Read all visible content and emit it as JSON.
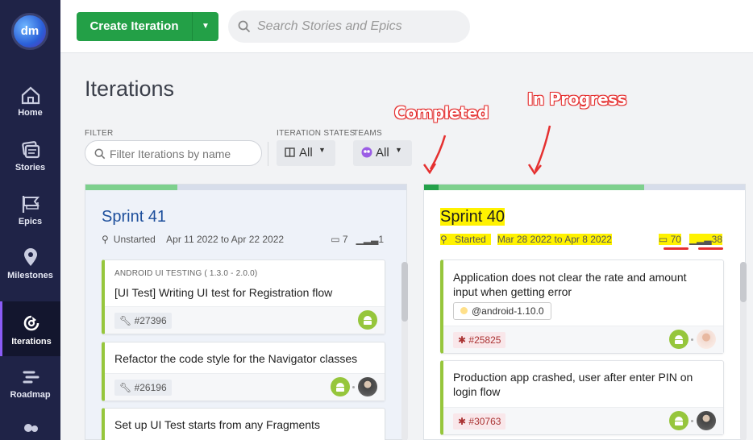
{
  "app": {
    "logo_text": "dm"
  },
  "sidebar": {
    "items": [
      {
        "label": "Home",
        "icon": "home-icon"
      },
      {
        "label": "Stories",
        "icon": "stories-icon"
      },
      {
        "label": "Epics",
        "icon": "epics-icon"
      },
      {
        "label": "Milestones",
        "icon": "milestones-icon"
      },
      {
        "label": "Iterations",
        "icon": "iterations-icon",
        "active": true
      },
      {
        "label": "Roadmap",
        "icon": "roadmap-icon"
      }
    ]
  },
  "topbar": {
    "create_label": "Create Iteration",
    "search_placeholder": "Search Stories and Epics"
  },
  "page": {
    "title": "Iterations"
  },
  "filters": {
    "filter_label": "FILTER",
    "filter_placeholder": "Filter Iterations by name",
    "states_label": "ITERATION STATES",
    "states_value": "All",
    "teams_label": "TEAMS",
    "teams_value": "All"
  },
  "annotations": {
    "completed": "Completed",
    "in_progress": "In Progress"
  },
  "iterations": [
    {
      "name": "Sprint 41",
      "state": "Unstarted",
      "dates": "Apr 11 2022 to Apr 22 2022",
      "story_count": "7",
      "points": "1",
      "cards": [
        {
          "epic": "ANDROID UI TESTING ( 1.3.0 - 2.0.0)",
          "title": "[UI Test] Writing UI test for Registration flow",
          "id": "#27396",
          "type": "chore"
        },
        {
          "epic": "",
          "title": "Refactor the code style for the Navigator classes",
          "id": "#26196",
          "type": "chore"
        },
        {
          "epic": "",
          "title": "Set up UI Test starts from any Fragments",
          "id": "",
          "type": "chore"
        }
      ]
    },
    {
      "name": "Sprint 40",
      "state": "Started",
      "dates": "Mar 28 2022 to Apr 8 2022",
      "story_count": "70",
      "points": "38",
      "cards": [
        {
          "title": "Application does not clear the rate and amount input when getting error",
          "label": "@android-1.10.0",
          "id": "#25825",
          "type": "bug"
        },
        {
          "title": "Production app crashed, user after enter PIN on login flow",
          "id": "#30763",
          "type": "bug"
        }
      ]
    }
  ],
  "colors": {
    "sidebar_bg": "#1f2347",
    "create_green": "#23a047",
    "android_green": "#96c63c",
    "annotation_red": "#e53030",
    "highlight_yellow": "#fff200"
  }
}
